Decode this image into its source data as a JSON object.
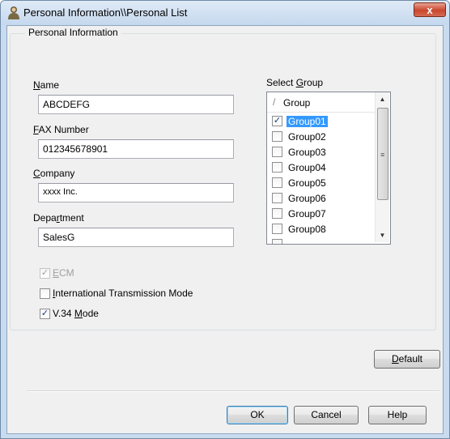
{
  "window": {
    "title": "Personal Information\\\\Personal List",
    "close_label": "x"
  },
  "personal": {
    "group_title": "Personal Information",
    "name_label": "Name",
    "name_value": "ABCDEFG",
    "fax_label": "FAX Number",
    "fax_value": "012345678901",
    "company_label": "Company",
    "company_value": "xxxx Inc.",
    "department_label": "Department",
    "department_value": "SalesG"
  },
  "select_group": {
    "label": "Select Group",
    "header": "Group",
    "items": [
      {
        "label": "Group01",
        "checked": true,
        "selected": true
      },
      {
        "label": "Group02",
        "checked": false
      },
      {
        "label": "Group03",
        "checked": false
      },
      {
        "label": "Group04",
        "checked": false
      },
      {
        "label": "Group05",
        "checked": false
      },
      {
        "label": "Group06",
        "checked": false
      },
      {
        "label": "Group07",
        "checked": false
      },
      {
        "label": "Group08",
        "checked": false
      }
    ]
  },
  "options": {
    "ecm_label": "ECM",
    "ecm_checked": true,
    "ecm_disabled": true,
    "itm_label": "International Transmission Mode",
    "itm_checked": false,
    "v34_label": "V.34 Mode",
    "v34_checked": true
  },
  "buttons": {
    "default": "Default",
    "ok": "OK",
    "cancel": "Cancel",
    "help": "Help"
  },
  "icons": {
    "title": "person-icon",
    "close": "close-icon",
    "check": "✓",
    "scroll_up": "▲",
    "scroll_down": "▼",
    "grip": "≡"
  }
}
